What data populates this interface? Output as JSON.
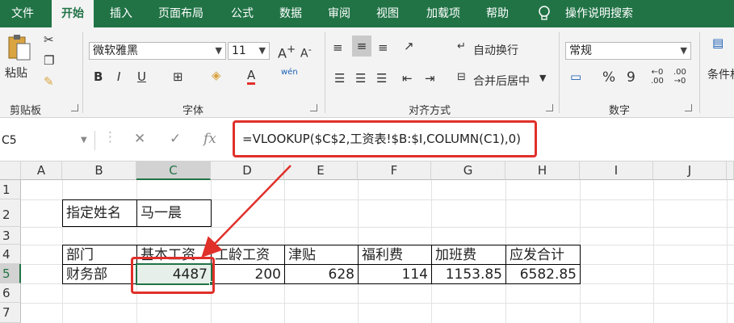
{
  "ribbon": {
    "tabs": [
      "文件",
      "开始",
      "插入",
      "页面布局",
      "公式",
      "数据",
      "审阅",
      "视图",
      "加载项",
      "帮助",
      "操作说明搜索"
    ],
    "clipboard": {
      "paste": "粘贴",
      "group": "剪贴板"
    },
    "font": {
      "name": "微软雅黑",
      "size": "11",
      "bold": "B",
      "italic": "I",
      "underline": "U",
      "color_a": "A",
      "wen": "wén",
      "group": "字体"
    },
    "alignment": {
      "wrap": "自动换行",
      "merge": "合并后居中",
      "group": "对齐方式"
    },
    "number": {
      "format": "常规",
      "percent": "%",
      "comma": "9",
      "group": "数字"
    },
    "styles": {
      "cond": "条件格"
    }
  },
  "formula_bar": {
    "name_box": "C5",
    "fx": "fx",
    "formula": "=VLOOKUP($C$2,工资表!$B:$I,COLUMN(C1),0)"
  },
  "grid": {
    "columns": [
      "A",
      "B",
      "C",
      "D",
      "E",
      "F",
      "G",
      "H",
      "I",
      "J"
    ],
    "rows": [
      "1",
      "2",
      "3",
      "4",
      "5",
      "6",
      "7"
    ],
    "lookup_label": "指定姓名",
    "lookup_name": "马一晨",
    "headers": [
      "部门",
      "基本工资",
      "工龄工资",
      "津贴",
      "福利费",
      "加班费",
      "应发合计"
    ],
    "values": [
      "财务部",
      "4487",
      "200",
      "628",
      "114",
      "1153.85",
      "6582.85"
    ]
  },
  "colors": {
    "accent": "#217346",
    "highlight": "#e0302a"
  }
}
